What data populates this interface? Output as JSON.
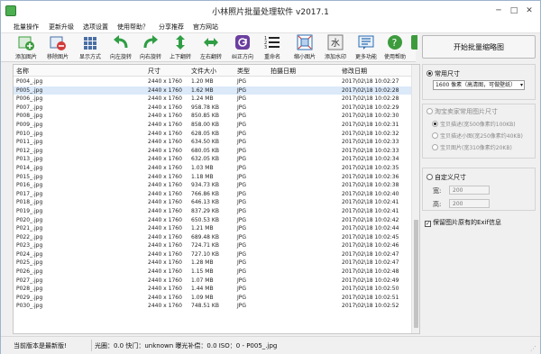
{
  "window": {
    "title": "小林照片批量处理软件 v2017.1",
    "minimize_glyph": "─",
    "maximize_glyph": "□",
    "close_glyph": "✕"
  },
  "menu": [
    "批量操作",
    "更新升级",
    "选项设置",
    "使用帮助？",
    "分享推荐",
    "官方网站"
  ],
  "toolbar": [
    {
      "label": "添加图片",
      "icon": "add-image-icon",
      "color": "#3d9b3d"
    },
    {
      "label": "移除图片",
      "icon": "remove-image-icon",
      "color": "#d23b3b"
    },
    {
      "label": "显示方式",
      "icon": "grid-view-icon",
      "color": "#4a6fa5"
    },
    {
      "label": "向左旋转",
      "icon": "rotate-left-icon",
      "color": "#2f9e44"
    },
    {
      "label": "向右旋转",
      "icon": "rotate-right-icon",
      "color": "#2f9e44"
    },
    {
      "label": "上下翻转",
      "icon": "flip-vertical-icon",
      "color": "#2f9e44"
    },
    {
      "label": "左右翻转",
      "icon": "flip-horizontal-icon",
      "color": "#2f9e44"
    },
    {
      "label": "纠正方向",
      "icon": "correct-orientation-icon",
      "color": "#6b3fa0"
    },
    {
      "label": "重命名",
      "icon": "rename-icon",
      "color": "#222222"
    },
    {
      "label": "缩小图片",
      "icon": "shrink-image-icon",
      "color": "#2b6cb0"
    },
    {
      "label": "添加水印",
      "icon": "watermark-icon",
      "color": "#555555"
    },
    {
      "label": "更多功能",
      "icon": "more-features-icon",
      "color": "#2b6cb0"
    },
    {
      "label": "使用帮助",
      "icon": "help-icon",
      "color": "#3d9b3d"
    },
    {
      "label": "",
      "icon": "exit-icon",
      "color": "#3d9b3d"
    }
  ],
  "start_button": "开始批量缩略图",
  "list": {
    "columns": [
      "名称",
      "尺寸",
      "文件大小",
      "类型",
      "拍摄日期",
      "修改日期"
    ],
    "rows": [
      [
        "P004_.jpg",
        "2440 x 1760",
        "1.20 MB",
        "JPG",
        "",
        "2017\\02\\18 10:02:27"
      ],
      [
        "P005_.jpg",
        "2440 x 1760",
        "1.62 MB",
        "JPG",
        "",
        "2017\\02\\18 10:02:28"
      ],
      [
        "P006_.jpg",
        "2440 x 1760",
        "1.24 MB",
        "JPG",
        "",
        "2017\\02\\18 10:02:28"
      ],
      [
        "P007_.jpg",
        "2440 x 1760",
        "958.78 KB",
        "JPG",
        "",
        "2017\\02\\18 10:02:29"
      ],
      [
        "P008_.jpg",
        "2440 x 1760",
        "850.85 KB",
        "JPG",
        "",
        "2017\\02\\18 10:02:30"
      ],
      [
        "P009_.jpg",
        "2440 x 1760",
        "858.00 KB",
        "JPG",
        "",
        "2017\\02\\18 10:02:31"
      ],
      [
        "P010_.jpg",
        "2440 x 1760",
        "628.05 KB",
        "JPG",
        "",
        "2017\\02\\18 10:02:32"
      ],
      [
        "P011_.jpg",
        "2440 x 1760",
        "634.50 KB",
        "JPG",
        "",
        "2017\\02\\18 10:02:33"
      ],
      [
        "P012_.jpg",
        "2440 x 1760",
        "680.05 KB",
        "JPG",
        "",
        "2017\\02\\18 10:02:33"
      ],
      [
        "P013_.jpg",
        "2440 x 1760",
        "632.05 KB",
        "JPG",
        "",
        "2017\\02\\18 10:02:34"
      ],
      [
        "P014_.jpg",
        "2440 x 1760",
        "1.03 MB",
        "JPG",
        "",
        "2017\\02\\18 10:02:35"
      ],
      [
        "P015_.jpg",
        "2440 x 1760",
        "1.18 MB",
        "JPG",
        "",
        "2017\\02\\18 10:02:36"
      ],
      [
        "P016_.jpg",
        "2440 x 1760",
        "934.73 KB",
        "JPG",
        "",
        "2017\\02\\18 10:02:38"
      ],
      [
        "P017_.jpg",
        "2440 x 1760",
        "766.86 KB",
        "JPG",
        "",
        "2017\\02\\18 10:02:40"
      ],
      [
        "P018_.jpg",
        "2440 x 1760",
        "646.13 KB",
        "JPG",
        "",
        "2017\\02\\18 10:02:41"
      ],
      [
        "P019_.jpg",
        "2440 x 1760",
        "837.29 KB",
        "JPG",
        "",
        "2017\\02\\18 10:02:41"
      ],
      [
        "P020_.jpg",
        "2440 x 1760",
        "650.53 KB",
        "JPG",
        "",
        "2017\\02\\18 10:02:42"
      ],
      [
        "P021_.jpg",
        "2440 x 1760",
        "1.21 MB",
        "JPG",
        "",
        "2017\\02\\18 10:02:44"
      ],
      [
        "P022_.jpg",
        "2440 x 1760",
        "689.48 KB",
        "JPG",
        "",
        "2017\\02\\18 10:02:45"
      ],
      [
        "P023_.jpg",
        "2440 x 1760",
        "724.71 KB",
        "JPG",
        "",
        "2017\\02\\18 10:02:46"
      ],
      [
        "P024_.jpg",
        "2440 x 1760",
        "727.10 KB",
        "JPG",
        "",
        "2017\\02\\18 10:02:47"
      ],
      [
        "P025_.jpg",
        "2440 x 1760",
        "1.28 MB",
        "JPG",
        "",
        "2017\\02\\18 10:02:47"
      ],
      [
        "P026_.jpg",
        "2440 x 1760",
        "1.15 MB",
        "JPG",
        "",
        "2017\\02\\18 10:02:48"
      ],
      [
        "P027_.jpg",
        "2440 x 1760",
        "1.07 MB",
        "JPG",
        "",
        "2017\\02\\18 10:02:49"
      ],
      [
        "P028_.jpg",
        "2440 x 1760",
        "1.44 MB",
        "JPG",
        "",
        "2017\\02\\18 10:02:50"
      ],
      [
        "P029_.jpg",
        "2440 x 1760",
        "1.09 MB",
        "JPG",
        "",
        "2017\\02\\18 10:02:51"
      ],
      [
        "P030_.jpg",
        "2440 x 1760",
        "748.51 KB",
        "JPG",
        "",
        "2017\\02\\18 10:02:52"
      ]
    ]
  },
  "panel": {
    "common_size_label": "常用尺寸",
    "common_size_value": "1600 像素（高清图，可做壁纸）",
    "taobao_label": "淘宝卖家常用图片尺寸",
    "taobao_options": [
      "宝贝描述(宽500像素约100KB)",
      "宝贝描述小图(宽250像素约40KB)",
      "宝贝图片(宽310像素约20KB)"
    ],
    "custom_label": "自定义尺寸",
    "width_label": "宽:",
    "width_value": "200",
    "height_label": "高:",
    "height_value": "200",
    "exif_label": "保留图片原有的Exif信息",
    "exif_checked": "✓"
  },
  "status": {
    "left": "当前版本是最新版!",
    "right": "光圈：0.0 快门：unknown 曝光补偿：0.0 ISO：0 - P005_.jpg"
  }
}
